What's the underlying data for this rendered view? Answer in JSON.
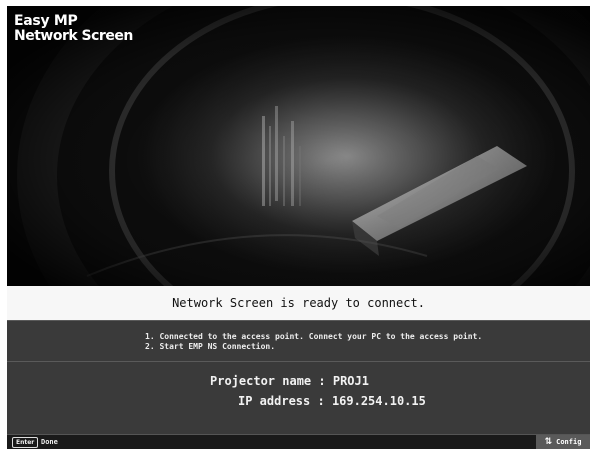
{
  "logo": {
    "line1": "Easy MP",
    "line2": "Network Screen"
  },
  "status_message": "Network Screen is ready to connect.",
  "instructions": [
    "1. Connected to the access point. Connect your PC to the access point.",
    "2. Start EMP NS Connection."
  ],
  "projector": {
    "name_label": "Projector name",
    "name_value": "PROJ1",
    "ip_label": "IP address",
    "ip_value": "169.254.10.15",
    "separator": ":"
  },
  "footer": {
    "enter_key": "Enter",
    "enter_action": "Done",
    "config_label": "Config"
  },
  "icons": [
    "config-icon"
  ]
}
